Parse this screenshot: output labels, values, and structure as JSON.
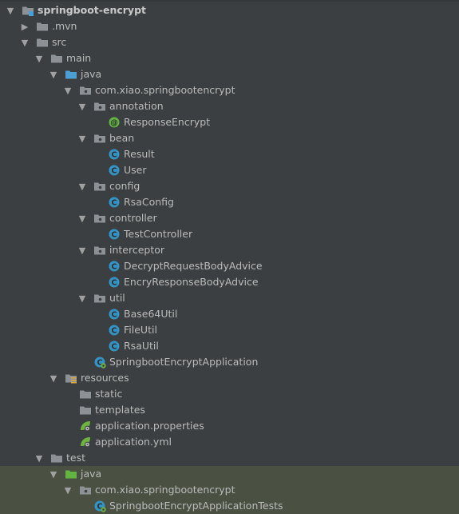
{
  "project_tree": {
    "colors": {
      "background": "#3c3f41",
      "highlight_row": "#4a5143",
      "folder": "#8c9196",
      "source_folder": "#4b9fd5",
      "test_folder": "#62b543",
      "class_badge": "#3592c4",
      "annotation_badge": "#62b543",
      "spring_leaf": "#6db33f"
    },
    "rows": [
      {
        "label": "springboot-encrypt",
        "depth": 0,
        "arrow": "down",
        "icon": "module-folder-icon",
        "bold": true
      },
      {
        "label": ".mvn",
        "depth": 1,
        "arrow": "right",
        "icon": "folder-icon"
      },
      {
        "label": "src",
        "depth": 1,
        "arrow": "down",
        "icon": "folder-icon"
      },
      {
        "label": "main",
        "depth": 2,
        "arrow": "down",
        "icon": "folder-icon"
      },
      {
        "label": "java",
        "depth": 3,
        "arrow": "down",
        "icon": "source-folder-icon"
      },
      {
        "label": "com.xiao.springbootencrypt",
        "depth": 4,
        "arrow": "down",
        "icon": "package-icon"
      },
      {
        "label": "annotation",
        "depth": 5,
        "arrow": "down",
        "icon": "package-icon"
      },
      {
        "label": "ResponseEncrypt",
        "depth": 6,
        "arrow": "none",
        "icon": "annotation-icon"
      },
      {
        "label": "bean",
        "depth": 5,
        "arrow": "down",
        "icon": "package-icon"
      },
      {
        "label": "Result",
        "depth": 6,
        "arrow": "none",
        "icon": "class-icon"
      },
      {
        "label": "User",
        "depth": 6,
        "arrow": "none",
        "icon": "class-icon"
      },
      {
        "label": "config",
        "depth": 5,
        "arrow": "down",
        "icon": "package-icon"
      },
      {
        "label": "RsaConfig",
        "depth": 6,
        "arrow": "none",
        "icon": "class-icon"
      },
      {
        "label": "controller",
        "depth": 5,
        "arrow": "down",
        "icon": "package-icon"
      },
      {
        "label": "TestController",
        "depth": 6,
        "arrow": "none",
        "icon": "class-icon"
      },
      {
        "label": "interceptor",
        "depth": 5,
        "arrow": "down",
        "icon": "package-icon"
      },
      {
        "label": "DecryptRequestBodyAdvice",
        "depth": 6,
        "arrow": "none",
        "icon": "class-icon"
      },
      {
        "label": "EncryResponseBodyAdvice",
        "depth": 6,
        "arrow": "none",
        "icon": "class-icon"
      },
      {
        "label": "util",
        "depth": 5,
        "arrow": "down",
        "icon": "package-icon"
      },
      {
        "label": "Base64Util",
        "depth": 6,
        "arrow": "none",
        "icon": "class-icon"
      },
      {
        "label": "FileUtil",
        "depth": 6,
        "arrow": "none",
        "icon": "class-icon"
      },
      {
        "label": "RsaUtil",
        "depth": 6,
        "arrow": "none",
        "icon": "class-icon"
      },
      {
        "label": "SpringbootEncryptApplication",
        "depth": 5,
        "arrow": "none",
        "icon": "spring-boot-class-icon"
      },
      {
        "label": "resources",
        "depth": 3,
        "arrow": "down",
        "icon": "resources-folder-icon"
      },
      {
        "label": "static",
        "depth": 4,
        "arrow": "none",
        "icon": "folder-icon"
      },
      {
        "label": "templates",
        "depth": 4,
        "arrow": "none",
        "icon": "folder-icon"
      },
      {
        "label": "application.properties",
        "depth": 4,
        "arrow": "none",
        "icon": "spring-config-icon"
      },
      {
        "label": "application.yml",
        "depth": 4,
        "arrow": "none",
        "icon": "spring-config-icon"
      },
      {
        "label": "test",
        "depth": 2,
        "arrow": "down",
        "icon": "folder-icon"
      },
      {
        "label": "java",
        "depth": 3,
        "arrow": "down",
        "icon": "test-source-folder-icon",
        "highlight": true
      },
      {
        "label": "com.xiao.springbootencrypt",
        "depth": 4,
        "arrow": "down",
        "icon": "package-icon",
        "highlight": true
      },
      {
        "label": "SpringbootEncryptApplicationTests",
        "depth": 5,
        "arrow": "none",
        "icon": "spring-boot-class-icon",
        "highlight": true
      }
    ]
  }
}
